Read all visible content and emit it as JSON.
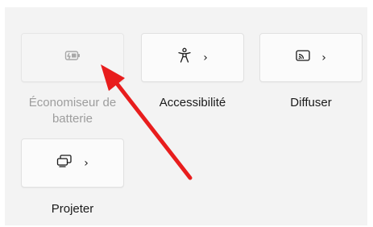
{
  "quick_settings": {
    "battery_saver": {
      "label": "Économiseur de batterie",
      "icon": "battery-saver-icon",
      "enabled": false
    },
    "accessibility": {
      "label": "Accessibilité",
      "icon": "accessibility-icon",
      "chevron": "›"
    },
    "cast": {
      "label": "Diffuser",
      "icon": "cast-icon",
      "chevron": "›"
    },
    "project": {
      "label": "Projeter",
      "icon": "project-icon",
      "chevron": "›"
    }
  },
  "annotation": {
    "arrow_color": "#e81d1d"
  }
}
